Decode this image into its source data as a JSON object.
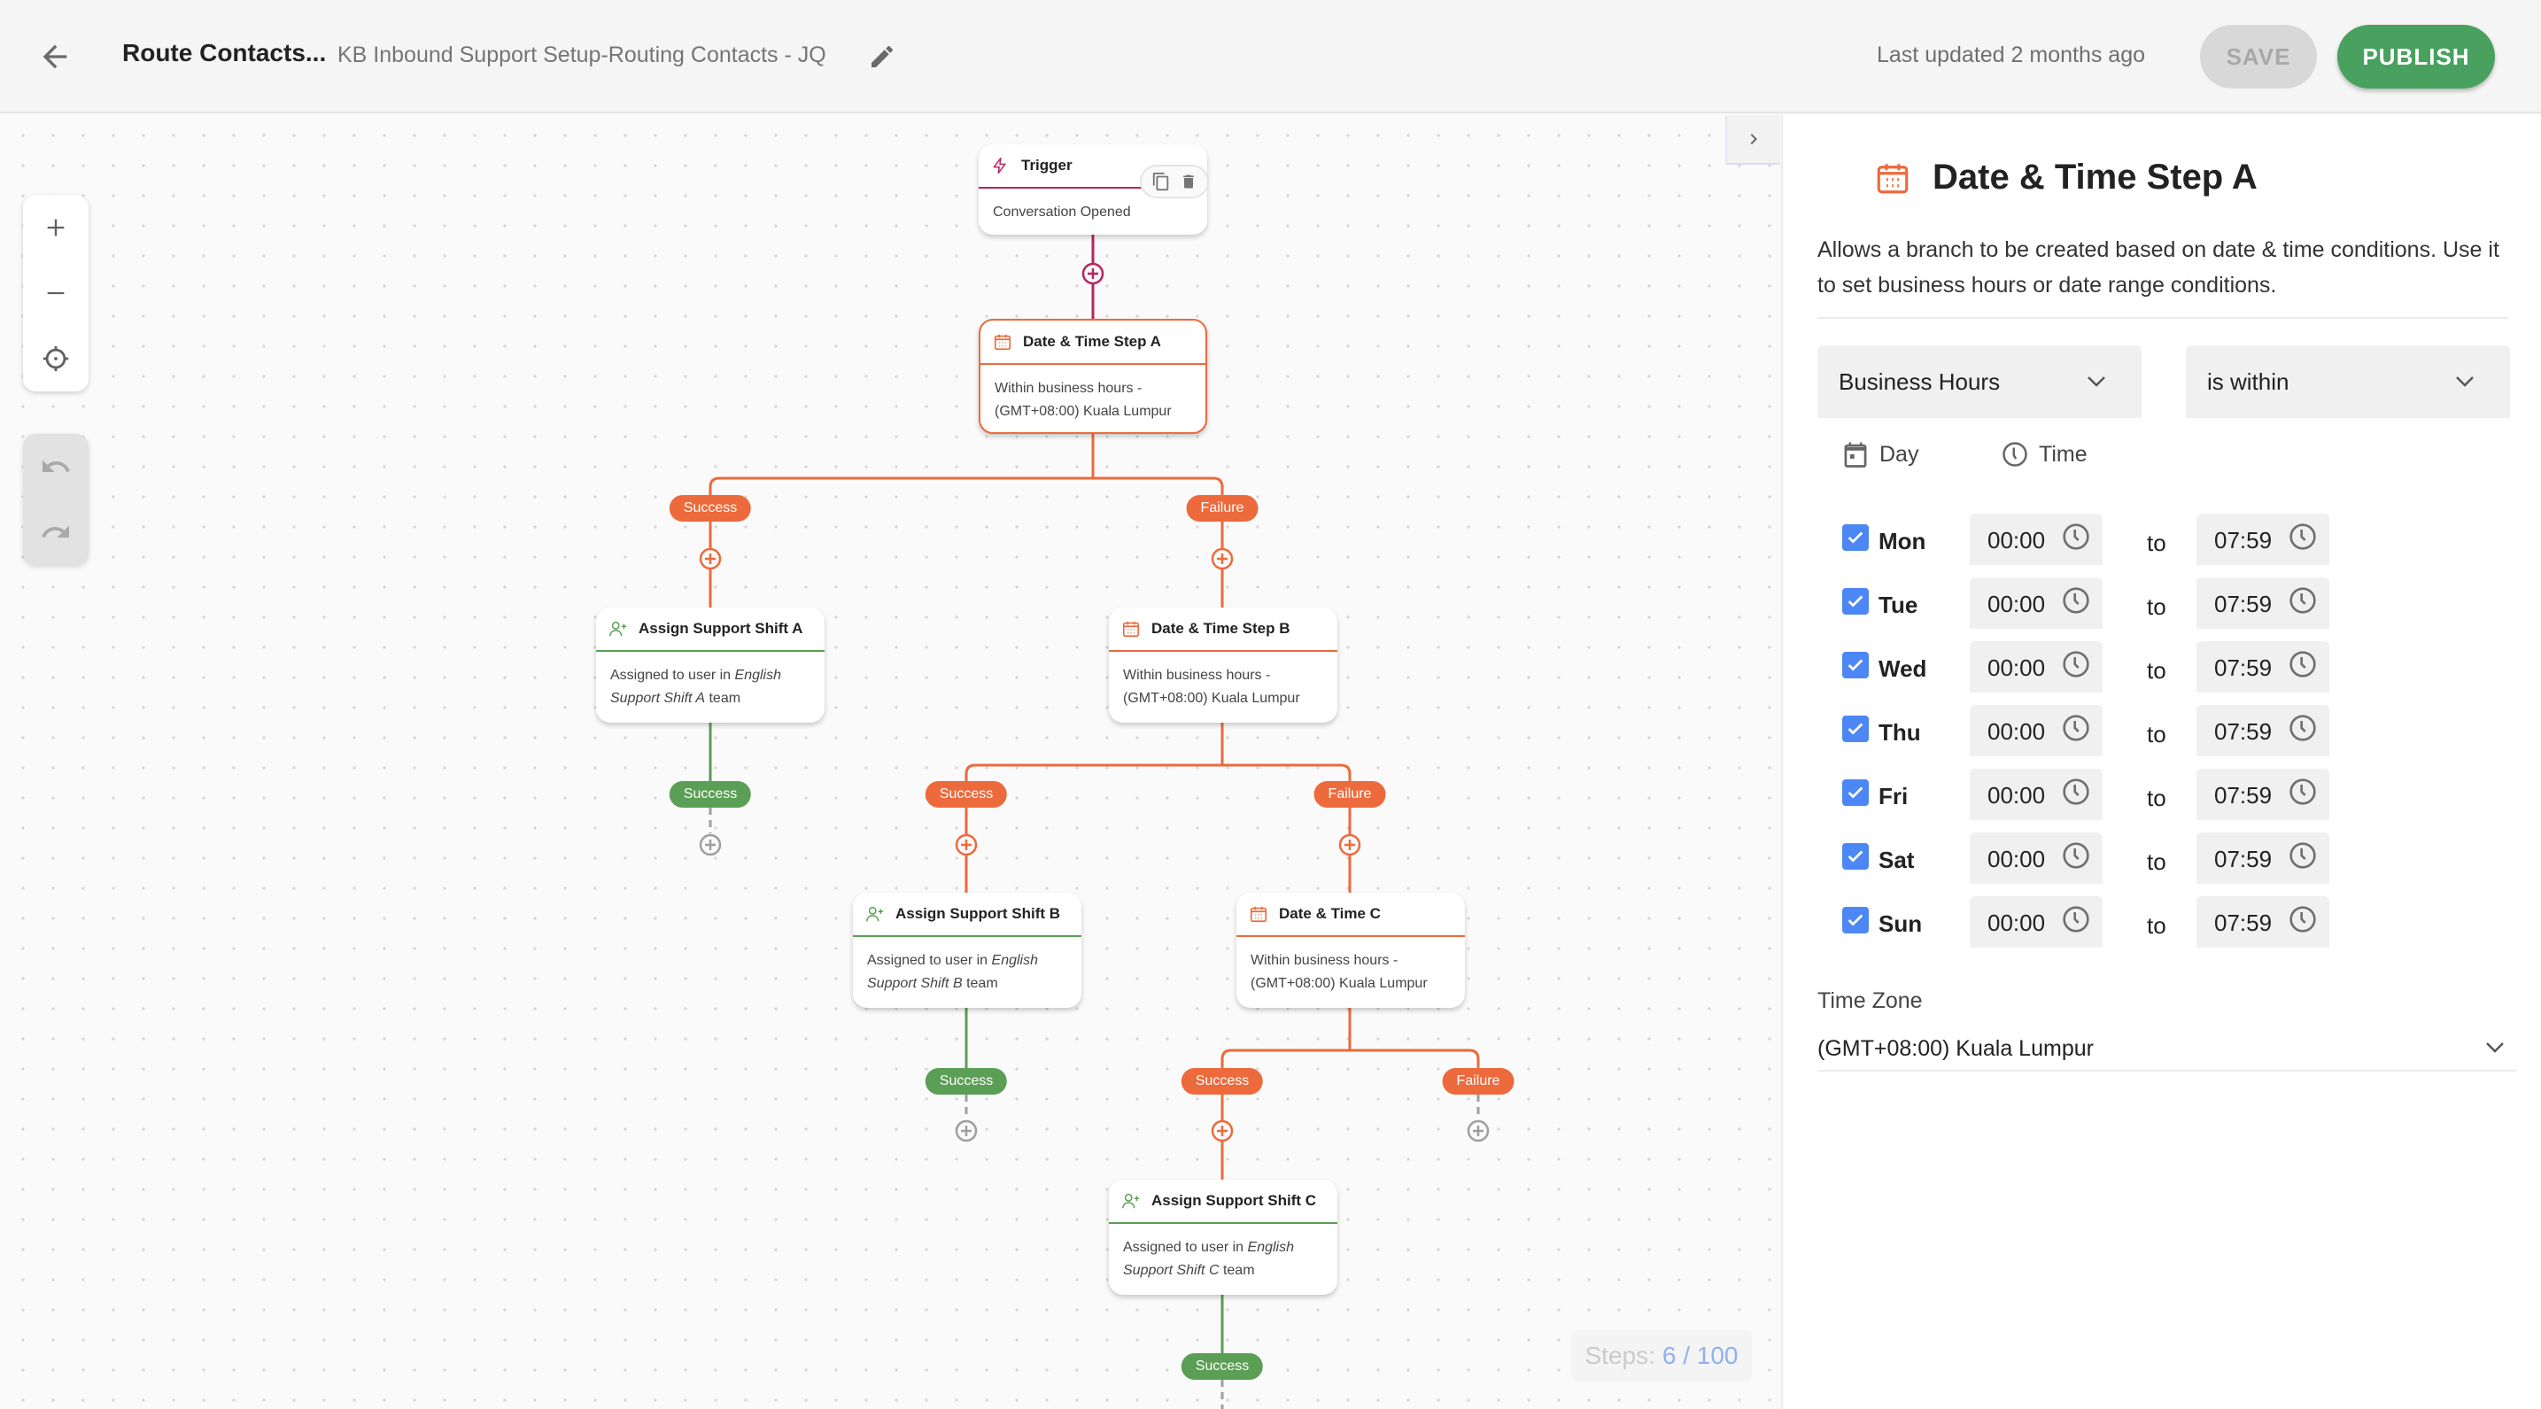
{
  "header": {
    "flow_title": "Route Contacts...",
    "flow_subtitle": "KB Inbound Support Setup-Routing Contacts - JQ",
    "last_updated": "Last updated 2 months ago",
    "save_label": "SAVE",
    "publish_label": "PUBLISH"
  },
  "canvas": {
    "nodes": {
      "trigger": {
        "title": "Trigger",
        "body": "Conversation Opened",
        "icon": "lightning-icon",
        "color": "#b8245f"
      },
      "date_a": {
        "title": "Date & Time Step A",
        "body_line1": "Within business hours -",
        "body_line2": "(GMT+08:00) Kuala Lumpur",
        "icon": "calendar-icon",
        "color": "#ec6a3c",
        "selected": true
      },
      "assign_a": {
        "title": "Assign Support Shift A",
        "body_prefix": "Assigned to user in ",
        "body_team_1": "English",
        "body_team_2": "Support Shift A",
        "body_suffix": " team",
        "icon": "user-plus-icon",
        "color": "#5b9e55"
      },
      "date_b": {
        "title": "Date & Time Step B",
        "body_line1": "Within business hours -",
        "body_line2": "(GMT+08:00) Kuala Lumpur",
        "icon": "calendar-icon",
        "color": "#ec6a3c"
      },
      "assign_b": {
        "title": "Assign Support Shift B",
        "body_prefix": "Assigned to user in ",
        "body_team_1": "English",
        "body_team_2": "Support Shift B",
        "body_suffix": " team",
        "icon": "user-plus-icon",
        "color": "#5b9e55"
      },
      "date_c": {
        "title": "Date & Time C",
        "body_line1": "Within business hours -",
        "body_line2": "(GMT+08:00) Kuala Lumpur",
        "icon": "calendar-icon",
        "color": "#ec6a3c"
      },
      "assign_c": {
        "title": "Assign Support Shift C",
        "body_prefix": "Assigned to user in ",
        "body_team_1": "English",
        "body_team_2": "Support Shift C",
        "body_suffix": " team",
        "icon": "user-plus-icon",
        "color": "#5b9e55"
      }
    },
    "badges": {
      "success": "Success",
      "failure": "Failure"
    },
    "steps_label": "Steps:",
    "steps_value": "6 / 100",
    "colors": {
      "trigger": "#b8245f",
      "datetime": "#ec6a3c",
      "assign": "#5b9e55",
      "inactive": "#9e9e9e"
    }
  },
  "panel": {
    "title": "Date & Time Step A",
    "description": "Allows a branch to be created based on date & time conditions. Use it to set business hours or date range conditions.",
    "condition_type": "Business Hours",
    "operator": "is within",
    "day_header": "Day",
    "time_header": "Time",
    "to_label": "to",
    "days": [
      {
        "name": "Mon",
        "checked": true,
        "from": "00:00",
        "to": "07:59"
      },
      {
        "name": "Tue",
        "checked": true,
        "from": "00:00",
        "to": "07:59"
      },
      {
        "name": "Wed",
        "checked": true,
        "from": "00:00",
        "to": "07:59"
      },
      {
        "name": "Thu",
        "checked": true,
        "from": "00:00",
        "to": "07:59"
      },
      {
        "name": "Fri",
        "checked": true,
        "from": "00:00",
        "to": "07:59"
      },
      {
        "name": "Sat",
        "checked": true,
        "from": "00:00",
        "to": "07:59"
      },
      {
        "name": "Sun",
        "checked": true,
        "from": "00:00",
        "to": "07:59"
      }
    ],
    "timezone_label": "Time Zone",
    "timezone_value": "(GMT+08:00) Kuala Lumpur",
    "accent": "#4d87f5"
  }
}
